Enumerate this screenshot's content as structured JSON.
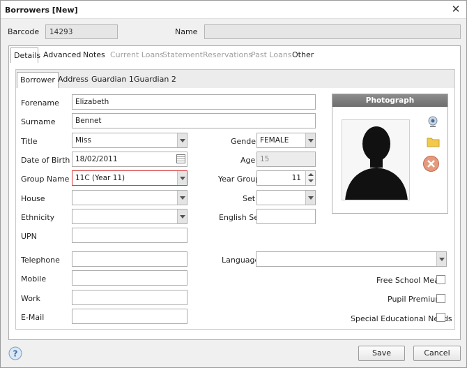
{
  "window": {
    "title": "Borrowers [New]",
    "close_glyph": "✕"
  },
  "header": {
    "barcode_label": "Barcode",
    "barcode_value": "14293",
    "name_label": "Name",
    "name_value": ""
  },
  "main_tabs": [
    {
      "label": "Details",
      "active": true,
      "enabled": true
    },
    {
      "label": "Advanced",
      "active": false,
      "enabled": true
    },
    {
      "label": "Notes",
      "active": false,
      "enabled": true
    },
    {
      "label": "Current Loans",
      "active": false,
      "enabled": false
    },
    {
      "label": "Statement",
      "active": false,
      "enabled": false
    },
    {
      "label": "Reservations",
      "active": false,
      "enabled": false
    },
    {
      "label": "Past Loans",
      "active": false,
      "enabled": false
    },
    {
      "label": "Other",
      "active": false,
      "enabled": true
    }
  ],
  "sub_tabs": [
    {
      "label": "Borrower",
      "active": true
    },
    {
      "label": "Address",
      "active": false
    },
    {
      "label": "Guardian 1",
      "active": false
    },
    {
      "label": "Guardian 2",
      "active": false
    }
  ],
  "form": {
    "forename": {
      "label": "Forename",
      "value": "Elizabeth"
    },
    "surname": {
      "label": "Surname",
      "value": "Bennet"
    },
    "title": {
      "label": "Title",
      "value": "Miss"
    },
    "dob": {
      "label": "Date of Birth",
      "value": "18/02/2011"
    },
    "group_name": {
      "label": "Group Name",
      "value": "11C (Year 11)"
    },
    "house": {
      "label": "House",
      "value": ""
    },
    "ethnicity": {
      "label": "Ethnicity",
      "value": ""
    },
    "upn": {
      "label": "UPN",
      "value": ""
    },
    "gender": {
      "label": "Gender",
      "value": "FEMALE"
    },
    "age": {
      "label": "Age",
      "value": "15"
    },
    "year_group": {
      "label": "Year Group",
      "value": "11"
    },
    "set": {
      "label": "Set",
      "value": ""
    },
    "english_set": {
      "label": "English Set",
      "value": ""
    },
    "telephone": {
      "label": "Telephone",
      "value": ""
    },
    "mobile": {
      "label": "Mobile",
      "value": ""
    },
    "work": {
      "label": "Work",
      "value": ""
    },
    "email": {
      "label": "E-Mail",
      "value": ""
    },
    "language": {
      "label": "Language",
      "value": ""
    },
    "free_school_meals": {
      "label": "Free School Meals",
      "checked": false
    },
    "pupil_premium": {
      "label": "Pupil Premium",
      "checked": false
    },
    "special_needs": {
      "label": "Special Educational Needs",
      "checked": false
    }
  },
  "photograph": {
    "header": "Photograph"
  },
  "footer": {
    "save_label": "Save",
    "cancel_label": "Cancel"
  },
  "colors": {
    "error_border": "#d63a3a",
    "photo_header": "#7a7a7a"
  }
}
